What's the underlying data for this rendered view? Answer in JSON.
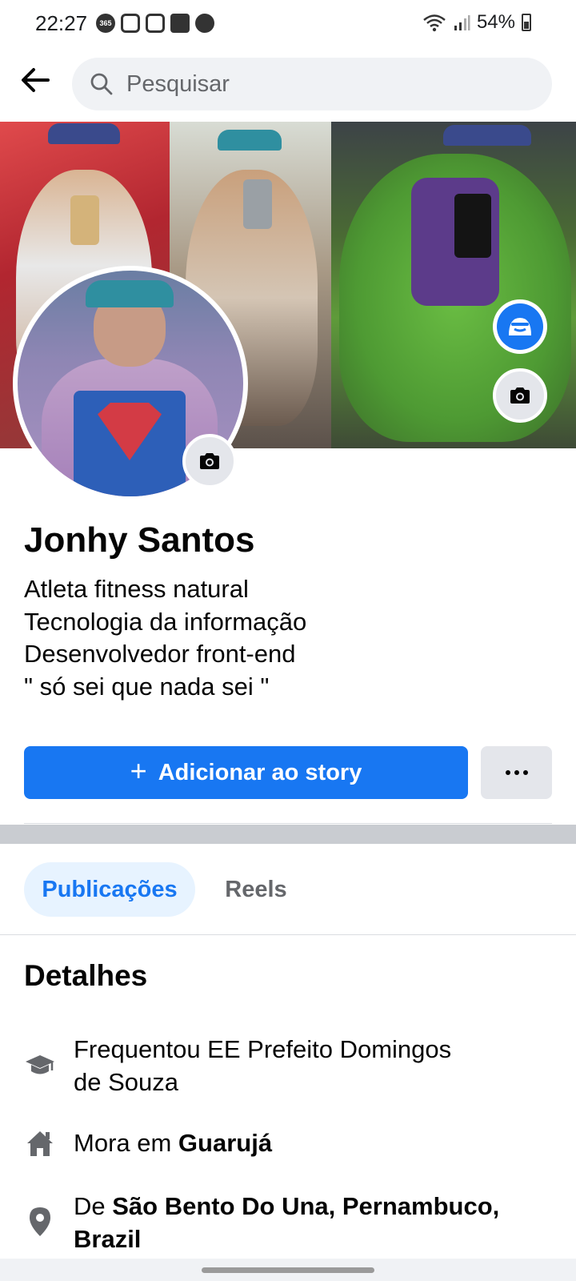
{
  "status_bar": {
    "time": "22:27",
    "notification_icons": [
      "365-icon",
      "instagram-icon",
      "instagram-icon",
      "gallery-icon",
      "soccer-ball-icon"
    ],
    "battery": "54%"
  },
  "search": {
    "placeholder": "Pesquisar"
  },
  "profile": {
    "name": "Jonhy Santos",
    "bio": [
      "Atleta fitness natural",
      "Tecnologia da informação",
      "Desenvolvedor front-end",
      "\" só sei que nada sei \""
    ]
  },
  "actions": {
    "add_story_label": "Adicionar ao story"
  },
  "tabs": [
    {
      "label": "Publicações",
      "active": true
    },
    {
      "label": "Reels",
      "active": false
    }
  ],
  "details": {
    "title": "Detalhes",
    "education": {
      "line1": "Frequentou EE Prefeito Domingos",
      "line2": "de Souza"
    },
    "lives_in": {
      "prefix": "Mora em ",
      "place": "Guarujá"
    },
    "from": {
      "prefix": "De ",
      "place_line1": "São Bento Do Una, Pernambuco,",
      "place_line2": "Brazil"
    }
  },
  "colors": {
    "accent": "#1877f2",
    "tab_active_bg": "#e7f3ff",
    "secondary_button": "#e4e6eb",
    "divider": "#c9ccd1"
  }
}
